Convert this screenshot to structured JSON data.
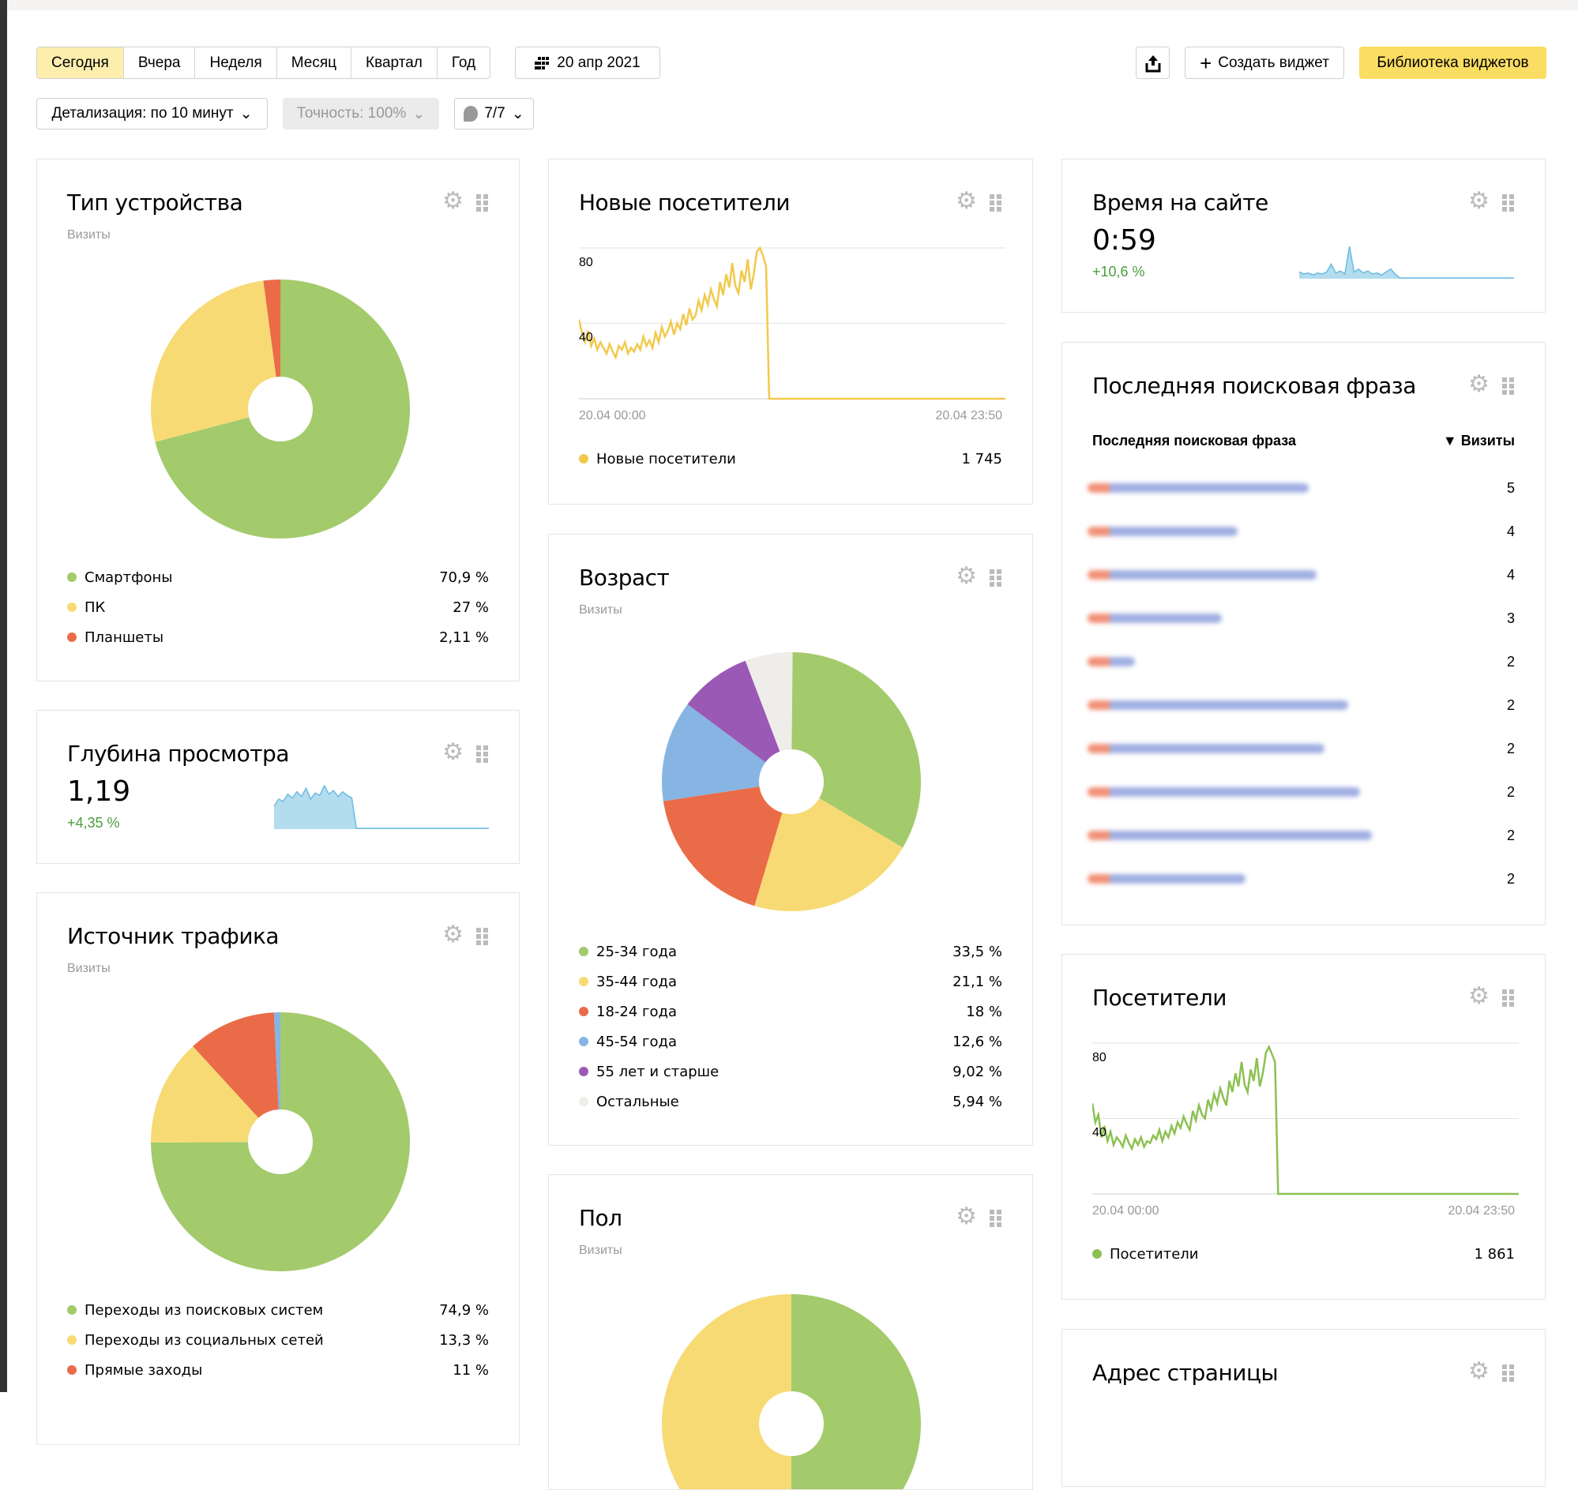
{
  "toolbar": {
    "periods": [
      "Сегодня",
      "Вчера",
      "Неделя",
      "Месяц",
      "Квартал",
      "Год"
    ],
    "active_period": "Сегодня",
    "date": "20 апр 2021",
    "create_widget": "Создать виджет",
    "library": "Библиотека виджетов",
    "detail": "Детализация: по 10 минут",
    "accuracy": "Точность: 100%",
    "segments": "7/7"
  },
  "colors": {
    "green": "#a3ca6b",
    "yellow": "#f7da74",
    "red": "#ea6b48",
    "blue": "#86b5e3",
    "purple": "#9b59b6",
    "other": "#efede9",
    "accent": "#fadd63",
    "spark": "#6bbce0"
  },
  "device": {
    "title": "Тип устройства",
    "subtitle": "Визиты",
    "chart_data": {
      "type": "pie",
      "labels": [
        "Смартфоны",
        "ПК",
        "Планшеты"
      ],
      "values": [
        70.9,
        27,
        2.11
      ],
      "display": [
        "70,9 %",
        "27 %",
        "2,11 %"
      ],
      "colors": [
        "#a3ca6b",
        "#f7da74",
        "#ea6b48"
      ]
    }
  },
  "depth": {
    "title": "Глубина просмотра",
    "value": "1,19",
    "delta": "+4,35 %",
    "chart_data": {
      "type": "area",
      "values": [
        18,
        24,
        22,
        28,
        25,
        30,
        26,
        33,
        24,
        29,
        27,
        35,
        28,
        31,
        26,
        30,
        27,
        25,
        0,
        0,
        0,
        0,
        0,
        0,
        0,
        0,
        0,
        0,
        0,
        0,
        0,
        0,
        0,
        0,
        0,
        0,
        0,
        0,
        0,
        0,
        0,
        0,
        0,
        0,
        0,
        0,
        0,
        0
      ]
    }
  },
  "source": {
    "title": "Источник трафика",
    "subtitle": "Визиты",
    "chart_data": {
      "type": "pie",
      "labels": [
        "Переходы из поисковых систем",
        "Переходы из социальных сетей",
        "Прямые заходы"
      ],
      "values": [
        74.9,
        13.3,
        11
      ],
      "display": [
        "74,9 %",
        "13,3 %",
        "11 %"
      ],
      "colors": [
        "#a3ca6b",
        "#f7da74",
        "#ea6b48"
      ]
    }
  },
  "new_visitors": {
    "title": "Новые посетители",
    "legend": "Новые посетители",
    "total": "1 745",
    "x_start": "20.04 00:00",
    "x_end": "20.04 23:50",
    "y_ticks": [
      "80",
      "40"
    ],
    "chart_data": {
      "type": "line",
      "ylim": [
        0,
        80
      ],
      "color": "#f2c94c",
      "values": [
        42,
        35,
        30,
        36,
        28,
        32,
        26,
        30,
        27,
        24,
        29,
        25,
        22,
        28,
        26,
        30,
        24,
        27,
        25,
        29,
        26,
        33,
        28,
        31,
        27,
        35,
        30,
        38,
        33,
        36,
        41,
        34,
        40,
        37,
        45,
        39,
        48,
        42,
        44,
        52,
        47,
        55,
        50,
        58,
        53,
        49,
        62,
        55,
        66,
        59,
        72,
        60,
        56,
        68,
        62,
        74,
        58,
        66,
        78,
        80,
        76,
        70,
        0,
        0,
        0,
        0,
        0,
        0,
        0,
        0,
        0,
        0,
        0,
        0,
        0,
        0,
        0,
        0,
        0,
        0,
        0,
        0,
        0,
        0,
        0,
        0,
        0,
        0,
        0,
        0,
        0,
        0,
        0,
        0,
        0,
        0,
        0,
        0,
        0,
        0,
        0,
        0,
        0,
        0,
        0,
        0,
        0,
        0,
        0,
        0,
        0,
        0,
        0,
        0,
        0,
        0,
        0,
        0,
        0,
        0,
        0,
        0,
        0,
        0,
        0,
        0,
        0,
        0,
        0,
        0,
        0,
        0,
        0,
        0,
        0,
        0,
        0,
        0,
        0,
        0
      ]
    }
  },
  "age": {
    "title": "Возраст",
    "subtitle": "Визиты",
    "chart_data": {
      "type": "pie",
      "labels": [
        "25-34 года",
        "35-44 года",
        "18-24 года",
        "45-54 года",
        "55 лет и старше",
        "Остальные"
      ],
      "values": [
        33.5,
        21.1,
        18,
        12.6,
        9.02,
        5.94
      ],
      "display": [
        "33,5 %",
        "21,1 %",
        "18 %",
        "12,6 %",
        "9,02 %",
        "5,94 %"
      ],
      "colors": [
        "#a3ca6b",
        "#f7da74",
        "#ea6b48",
        "#86b5e3",
        "#9b59b6",
        "#efede9"
      ]
    }
  },
  "gender": {
    "title": "Пол",
    "subtitle": "Визиты",
    "chart_data": {
      "type": "pie",
      "values": [
        50,
        50
      ],
      "colors": [
        "#a3ca6b",
        "#f7da74"
      ]
    }
  },
  "time": {
    "title": "Время на сайте",
    "value": "0:59",
    "delta": "+10,6 %",
    "chart_data": {
      "type": "area",
      "values": [
        6,
        4,
        5,
        3,
        5,
        4,
        6,
        14,
        5,
        7,
        4,
        32,
        6,
        9,
        5,
        7,
        4,
        5,
        3,
        6,
        9,
        4,
        0,
        0,
        0,
        0,
        0,
        0,
        0,
        0,
        0,
        0,
        0,
        0,
        0,
        0,
        0,
        0,
        0,
        0,
        0,
        0,
        0,
        0,
        0,
        0,
        0,
        0
      ]
    }
  },
  "search": {
    "title": "Последняя поисковая фраза",
    "col_phrase": "Последняя поисковая фраза",
    "col_visits": "▼ Визиты",
    "rows": [
      {
        "visits": "5"
      },
      {
        "visits": "4"
      },
      {
        "visits": "4"
      },
      {
        "visits": "3"
      },
      {
        "visits": "2"
      },
      {
        "visits": "2"
      },
      {
        "visits": "2"
      },
      {
        "visits": "2"
      },
      {
        "visits": "2"
      },
      {
        "visits": "2"
      }
    ]
  },
  "visitors": {
    "title": "Посетители",
    "legend": "Посетители",
    "total": "1 861",
    "x_start": "20.04 00:00",
    "x_end": "20.04 23:50",
    "y_ticks": [
      "80",
      "40"
    ],
    "chart_data": {
      "type": "line",
      "ylim": [
        0,
        80
      ],
      "color": "#8cc152",
      "values": [
        48,
        38,
        42,
        30,
        36,
        28,
        33,
        26,
        30,
        28,
        25,
        31,
        27,
        24,
        29,
        26,
        30,
        25,
        28,
        27,
        31,
        29,
        34,
        28,
        33,
        30,
        36,
        32,
        38,
        35,
        41,
        37,
        34,
        44,
        39,
        47,
        42,
        40,
        50,
        45,
        53,
        48,
        56,
        51,
        47,
        60,
        54,
        64,
        57,
        70,
        58,
        54,
        66,
        60,
        72,
        57,
        64,
        75,
        78,
        74,
        70,
        0,
        0,
        0,
        0,
        0,
        0,
        0,
        0,
        0,
        0,
        0,
        0,
        0,
        0,
        0,
        0,
        0,
        0,
        0,
        0,
        0,
        0,
        0,
        0,
        0,
        0,
        0,
        0,
        0,
        0,
        0,
        0,
        0,
        0,
        0,
        0,
        0,
        0,
        0,
        0,
        0,
        0,
        0,
        0,
        0,
        0,
        0,
        0,
        0,
        0,
        0,
        0,
        0,
        0,
        0,
        0,
        0,
        0,
        0,
        0,
        0,
        0,
        0,
        0,
        0,
        0,
        0,
        0,
        0,
        0,
        0,
        0,
        0,
        0,
        0,
        0,
        0,
        0,
        0,
        0
      ]
    }
  },
  "page_address": {
    "title": "Адрес страницы"
  }
}
